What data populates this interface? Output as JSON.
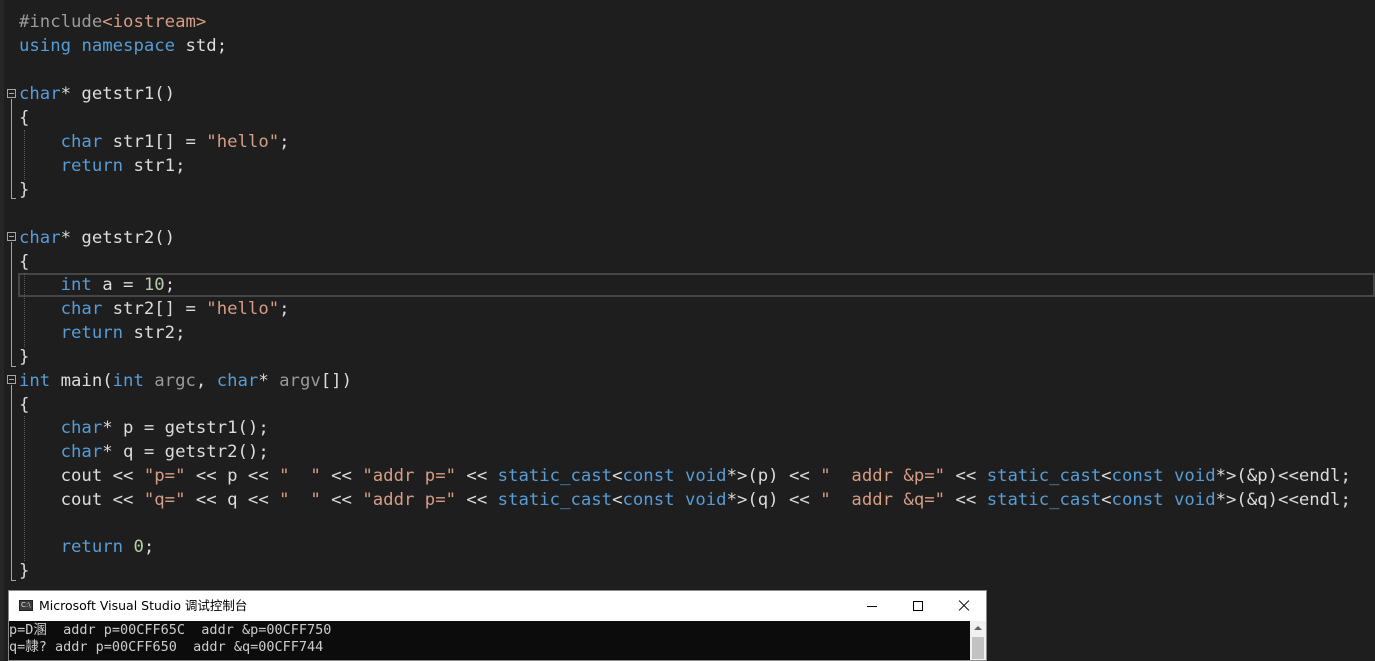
{
  "code": [
    {
      "tokens": [
        {
          "t": "#include",
          "c": "pp"
        },
        {
          "t": "<iostream>",
          "c": "str"
        }
      ]
    },
    {
      "tokens": [
        {
          "t": "using",
          "c": "kw"
        },
        {
          "t": " ",
          "c": "id"
        },
        {
          "t": "namespace",
          "c": "kw"
        },
        {
          "t": " std;",
          "c": "id"
        }
      ]
    },
    {
      "tokens": []
    },
    {
      "tokens": [
        {
          "t": "char",
          "c": "kw"
        },
        {
          "t": "* getstr1()",
          "c": "id"
        }
      ]
    },
    {
      "tokens": [
        {
          "t": "{",
          "c": "id"
        }
      ]
    },
    {
      "tokens": [
        {
          "t": "    ",
          "c": "id"
        },
        {
          "t": "char",
          "c": "kw"
        },
        {
          "t": " str1[] = ",
          "c": "id"
        },
        {
          "t": "\"hello\"",
          "c": "str"
        },
        {
          "t": ";",
          "c": "id"
        }
      ]
    },
    {
      "tokens": [
        {
          "t": "    ",
          "c": "id"
        },
        {
          "t": "return",
          "c": "kw"
        },
        {
          "t": " str1;",
          "c": "id"
        }
      ]
    },
    {
      "tokens": [
        {
          "t": "}",
          "c": "id"
        }
      ]
    },
    {
      "tokens": []
    },
    {
      "tokens": [
        {
          "t": "char",
          "c": "kw"
        },
        {
          "t": "* getstr2()",
          "c": "id"
        }
      ]
    },
    {
      "tokens": [
        {
          "t": "{",
          "c": "id"
        }
      ]
    },
    {
      "tokens": [
        {
          "t": "    ",
          "c": "id"
        },
        {
          "t": "int",
          "c": "kw"
        },
        {
          "t": " a = ",
          "c": "id"
        },
        {
          "t": "10",
          "c": "num"
        },
        {
          "t": ";",
          "c": "id"
        }
      ]
    },
    {
      "tokens": [
        {
          "t": "    ",
          "c": "id"
        },
        {
          "t": "char",
          "c": "kw"
        },
        {
          "t": " str2[] = ",
          "c": "id"
        },
        {
          "t": "\"hello\"",
          "c": "str"
        },
        {
          "t": ";",
          "c": "id"
        }
      ]
    },
    {
      "tokens": [
        {
          "t": "    ",
          "c": "id"
        },
        {
          "t": "return",
          "c": "kw"
        },
        {
          "t": " str2;",
          "c": "id"
        }
      ]
    },
    {
      "tokens": [
        {
          "t": "}",
          "c": "id"
        }
      ]
    },
    {
      "tokens": [
        {
          "t": "int",
          "c": "kw"
        },
        {
          "t": " main(",
          "c": "id"
        },
        {
          "t": "int",
          "c": "kw"
        },
        {
          "t": " ",
          "c": "id"
        },
        {
          "t": "argc",
          "c": "param"
        },
        {
          "t": ", ",
          "c": "id"
        },
        {
          "t": "char",
          "c": "kw"
        },
        {
          "t": "* ",
          "c": "id"
        },
        {
          "t": "argv",
          "c": "param"
        },
        {
          "t": "[])",
          "c": "id"
        }
      ]
    },
    {
      "tokens": [
        {
          "t": "{",
          "c": "id"
        }
      ]
    },
    {
      "tokens": [
        {
          "t": "    ",
          "c": "id"
        },
        {
          "t": "char",
          "c": "kw"
        },
        {
          "t": "* p = getstr1();",
          "c": "id"
        }
      ]
    },
    {
      "tokens": [
        {
          "t": "    ",
          "c": "id"
        },
        {
          "t": "char",
          "c": "kw"
        },
        {
          "t": "* q = getstr2();",
          "c": "id"
        }
      ]
    },
    {
      "tokens": [
        {
          "t": "    cout << ",
          "c": "id"
        },
        {
          "t": "\"p=\"",
          "c": "str"
        },
        {
          "t": " << p << ",
          "c": "id"
        },
        {
          "t": "\"  \"",
          "c": "str"
        },
        {
          "t": " << ",
          "c": "id"
        },
        {
          "t": "\"addr p=\"",
          "c": "str"
        },
        {
          "t": " << ",
          "c": "id"
        },
        {
          "t": "static_cast",
          "c": "kw"
        },
        {
          "t": "<",
          "c": "id"
        },
        {
          "t": "const",
          "c": "kw"
        },
        {
          "t": " ",
          "c": "id"
        },
        {
          "t": "void",
          "c": "kw"
        },
        {
          "t": "*>(p) << ",
          "c": "id"
        },
        {
          "t": "\"  addr &p=\"",
          "c": "str"
        },
        {
          "t": " << ",
          "c": "id"
        },
        {
          "t": "static_cast",
          "c": "kw"
        },
        {
          "t": "<",
          "c": "id"
        },
        {
          "t": "const",
          "c": "kw"
        },
        {
          "t": " ",
          "c": "id"
        },
        {
          "t": "void",
          "c": "kw"
        },
        {
          "t": "*>(&p)<<endl;",
          "c": "id"
        }
      ]
    },
    {
      "tokens": [
        {
          "t": "    cout << ",
          "c": "id"
        },
        {
          "t": "\"q=\"",
          "c": "str"
        },
        {
          "t": " << q << ",
          "c": "id"
        },
        {
          "t": "\"  \"",
          "c": "str"
        },
        {
          "t": " << ",
          "c": "id"
        },
        {
          "t": "\"addr p=\"",
          "c": "str"
        },
        {
          "t": " << ",
          "c": "id"
        },
        {
          "t": "static_cast",
          "c": "kw"
        },
        {
          "t": "<",
          "c": "id"
        },
        {
          "t": "const",
          "c": "kw"
        },
        {
          "t": " ",
          "c": "id"
        },
        {
          "t": "void",
          "c": "kw"
        },
        {
          "t": "*>(q) << ",
          "c": "id"
        },
        {
          "t": "\"  addr &q=\"",
          "c": "str"
        },
        {
          "t": " << ",
          "c": "id"
        },
        {
          "t": "static_cast",
          "c": "kw"
        },
        {
          "t": "<",
          "c": "id"
        },
        {
          "t": "const",
          "c": "kw"
        },
        {
          "t": " ",
          "c": "id"
        },
        {
          "t": "void",
          "c": "kw"
        },
        {
          "t": "*>(&q)<<endl;",
          "c": "id"
        }
      ]
    },
    {
      "tokens": []
    },
    {
      "tokens": [
        {
          "t": "    ",
          "c": "id"
        },
        {
          "t": "return",
          "c": "kw"
        },
        {
          "t": " ",
          "c": "id"
        },
        {
          "t": "0",
          "c": "num"
        },
        {
          "t": ";",
          "c": "id"
        }
      ]
    },
    {
      "tokens": [
        {
          "t": "}",
          "c": "id"
        }
      ]
    }
  ],
  "console": {
    "icon_text": "C:\\",
    "title": "Microsoft Visual Studio 调试控制台",
    "lines": [
      "p=D溷  addr p=00CFF65C  addr &p=00CFF750",
      "q=隷? addr p=00CFF650  addr &q=00CFF744"
    ]
  },
  "colors": {
    "background": "#1e1e1e",
    "keyword": "#569cd6",
    "string": "#d69d85",
    "number": "#b5cea8",
    "identifier": "#dcdcdc",
    "preprocessor": "#9b9b9b",
    "parameter": "#9a9a9a"
  }
}
